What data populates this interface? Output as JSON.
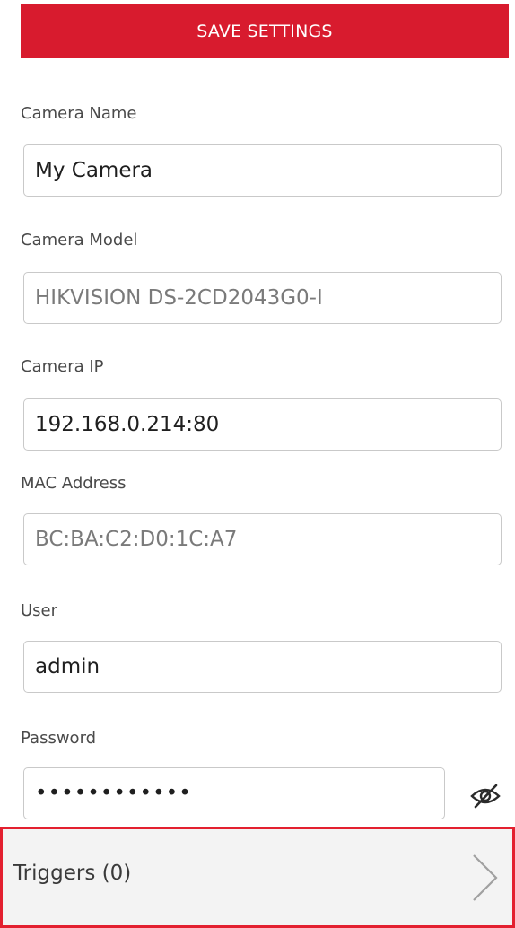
{
  "header": {
    "save_label": "SAVE SETTINGS",
    "accent_color": "#d81b2e"
  },
  "fields": {
    "camera_name": {
      "label": "Camera Name",
      "value": "My Camera"
    },
    "camera_model": {
      "label": "Camera Model",
      "value": "HIKVISION DS-2CD2043G0-I"
    },
    "camera_ip": {
      "label": "Camera IP",
      "value": "192.168.0.214:80"
    },
    "mac_address": {
      "label": "MAC Address",
      "value": "BC:BA:C2:D0:1C:A7"
    },
    "user": {
      "label": "User",
      "value": "admin"
    },
    "password": {
      "label": "Password",
      "value": "••••••••••••",
      "toggle_icon": "eye-slash-icon"
    }
  },
  "triggers": {
    "label": "Triggers  (0)",
    "icon": "chevron-right-icon",
    "highlight_color": "#e3202f"
  }
}
